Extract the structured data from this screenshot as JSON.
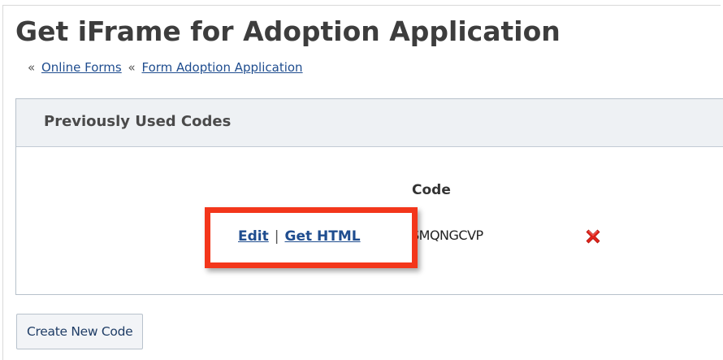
{
  "page": {
    "title": "Get iFrame for Adoption Application"
  },
  "breadcrumb": {
    "separator": "«",
    "items": [
      {
        "label": "Online Forms"
      },
      {
        "label": "Form Adoption Application"
      }
    ]
  },
  "codes_panel": {
    "title": "Previously Used Codes",
    "column_header": "Code",
    "rows": [
      {
        "edit_label": "Edit",
        "divider": "|",
        "get_html_label": "Get HTML",
        "code": "SMQNGCVP",
        "delete_icon": "red-x-icon"
      }
    ]
  },
  "actions": {
    "create_label": "Create New Code"
  },
  "colors": {
    "link": "#1f4d8f",
    "highlight": "#f3361b",
    "panel_header_bg": "#eef1f4",
    "delete_icon": "#e2231a"
  }
}
